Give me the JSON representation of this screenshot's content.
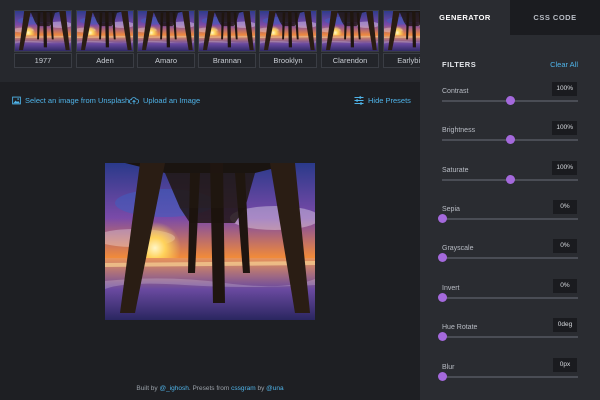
{
  "presets": [
    {
      "name": "1977"
    },
    {
      "name": "Aden"
    },
    {
      "name": "Amaro"
    },
    {
      "name": "Brannan"
    },
    {
      "name": "Brooklyn"
    },
    {
      "name": "Clarendon"
    },
    {
      "name": "Earlybird"
    }
  ],
  "actions": {
    "unsplash_label": "Select an image from Unsplash",
    "upload_label": "Upload an Image",
    "hide_presets_label": "Hide Presets"
  },
  "footer": {
    "prefix": "Built by ",
    "author": "@_ighosh",
    "middle": ". Presets from ",
    "source": "cssgram",
    "by": " by ",
    "source_author": "@una"
  },
  "panel": {
    "tabs": [
      {
        "label": "GENERATOR",
        "active": true
      },
      {
        "label": "CSS CODE",
        "active": false
      }
    ],
    "filters_title": "FILTERS",
    "clear_all_label": "Clear All",
    "filters": [
      {
        "label": "Contrast",
        "value": "100%",
        "level": 0.5
      },
      {
        "label": "Brightness",
        "value": "100%",
        "level": 0.5
      },
      {
        "label": "Saturate",
        "value": "100%",
        "level": 0.5
      },
      {
        "label": "Sepia",
        "value": "0%",
        "level": 0
      },
      {
        "label": "Grayscale",
        "value": "0%",
        "level": 0
      },
      {
        "label": "Invert",
        "value": "0%",
        "level": 0
      },
      {
        "label": "Hue Rotate",
        "value": "0deg",
        "level": 0
      },
      {
        "label": "Blur",
        "value": "0px",
        "level": 0
      }
    ]
  },
  "colors": {
    "accent": "#4fb3e8",
    "slider_knob": "#a469dc",
    "panel_bg": "#2a2c31",
    "page_bg": "#1e1f23"
  },
  "icons": {
    "unsplash": "image-icon",
    "upload": "cloud-upload-icon",
    "hide_presets": "sliders-icon"
  }
}
